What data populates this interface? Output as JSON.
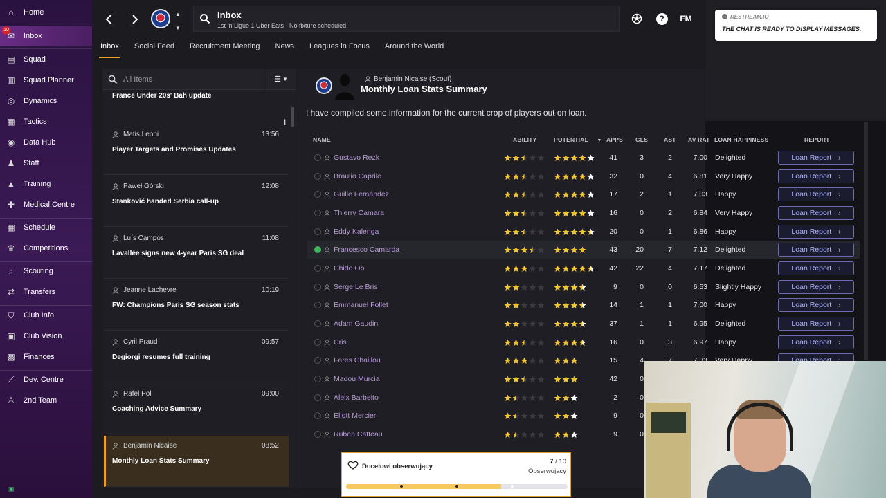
{
  "sidebar": {
    "items": [
      {
        "label": "Home",
        "icon": "home-icon"
      },
      {
        "label": "Inbox",
        "icon": "inbox-icon",
        "badge": "10"
      },
      {
        "label": "Squad",
        "icon": "shirt-icon"
      },
      {
        "label": "Squad Planner",
        "icon": "clipboard-icon"
      },
      {
        "label": "Dynamics",
        "icon": "dynamics-icon"
      },
      {
        "label": "Tactics",
        "icon": "tactics-icon"
      },
      {
        "label": "Data Hub",
        "icon": "data-hub-icon"
      },
      {
        "label": "Staff",
        "icon": "staff-icon"
      },
      {
        "label": "Training",
        "icon": "training-icon"
      },
      {
        "label": "Medical Centre",
        "icon": "medical-icon"
      },
      {
        "label": "Schedule",
        "icon": "calendar-icon"
      },
      {
        "label": "Competitions",
        "icon": "trophy-icon"
      },
      {
        "label": "Scouting",
        "icon": "search-icon"
      },
      {
        "label": "Transfers",
        "icon": "transfer-icon"
      },
      {
        "label": "Club Info",
        "icon": "shield-icon"
      },
      {
        "label": "Club Vision",
        "icon": "vision-icon"
      },
      {
        "label": "Finances",
        "icon": "money-icon"
      },
      {
        "label": "Dev. Centre",
        "icon": "dev-centre-icon"
      },
      {
        "label": "2nd Team",
        "icon": "team-icon"
      }
    ]
  },
  "header": {
    "title": "Inbox",
    "subtitle": "1st in Ligue 1 Uber Eats - No fixture scheduled.",
    "fm_label": "FM",
    "help_label": "?"
  },
  "tabs": [
    "Inbox",
    "Social Feed",
    "Recruitment Meeting",
    "News",
    "Leagues in Focus",
    "Around the World"
  ],
  "chat": {
    "source": "RESTREAM.IO",
    "message": "THE CHAT IS READY TO DISPLAY MESSAGES."
  },
  "message_list": {
    "search_placeholder": "All Items",
    "first_subject": "France Under 20s' Bah update",
    "items": [
      {
        "sender": "Matis Leoni",
        "time": "13:56",
        "subject": "Player Targets and Promises Updates"
      },
      {
        "sender": "Paweł Górski",
        "time": "12:08",
        "subject": "Stanković handed Serbia call-up"
      },
      {
        "sender": "Luís Campos",
        "time": "11:08",
        "subject": "Lavallée signs new 4-year Paris SG deal"
      },
      {
        "sender": "Jeanne Lachevre",
        "time": "10:19",
        "subject": "FW: Champions Paris SG season stats"
      },
      {
        "sender": "Cyril Praud",
        "time": "09:57",
        "subject": "Degiorgi resumes full training"
      },
      {
        "sender": "Rafel Pol",
        "time": "09:00",
        "subject": "Coaching Advice Summary"
      },
      {
        "sender": "Benjamin Nicaise",
        "time": "08:52",
        "subject": "Monthly Loan Stats Summary"
      }
    ]
  },
  "detail": {
    "from": "Benjamin Nicaise",
    "role": "(Scout)",
    "title": "Monthly Loan Stats Summary",
    "body": "I have compiled some information for the current crop of players out on loan."
  },
  "table": {
    "headers": {
      "name": "NAME",
      "ability": "ABILITY",
      "potential": "POTENTIAL",
      "apps": "APPS",
      "gls": "GLS",
      "ast": "AST",
      "avrat": "AV RAT",
      "happiness": "LOAN HAPPINESS",
      "report": "REPORT"
    },
    "button_label": "Loan Report",
    "rows": [
      {
        "name": "Gustavo Rezk",
        "ability": 2.5,
        "potential": 5,
        "potential_gold": 4,
        "apps": "41",
        "gls": "3",
        "ast": "2",
        "avrat": "7.00",
        "happiness": "Delighted"
      },
      {
        "name": "Braulio Caprile",
        "ability": 2.5,
        "potential": 5,
        "potential_gold": 4,
        "apps": "32",
        "gls": "0",
        "ast": "4",
        "avrat": "6.81",
        "happiness": "Very Happy"
      },
      {
        "name": "Guille Fernández",
        "ability": 2.5,
        "potential": 5,
        "potential_gold": 4,
        "apps": "17",
        "gls": "2",
        "ast": "1",
        "avrat": "7.03",
        "happiness": "Happy"
      },
      {
        "name": "Thierry Camara",
        "ability": 2.5,
        "potential": 5,
        "potential_gold": 4,
        "apps": "16",
        "gls": "0",
        "ast": "2",
        "avrat": "6.84",
        "happiness": "Very Happy"
      },
      {
        "name": "Eddy Kalenga",
        "ability": 2.5,
        "potential": 4.5,
        "potential_gold": 4,
        "apps": "20",
        "gls": "0",
        "ast": "1",
        "avrat": "6.86",
        "happiness": "Happy"
      },
      {
        "name": "Francesco Camarda",
        "ability": 3.5,
        "potential": 4,
        "potential_gold": 4,
        "apps": "43",
        "gls": "20",
        "ast": "7",
        "avrat": "7.12",
        "happiness": "Delighted",
        "highlight": true
      },
      {
        "name": "Chido Obi",
        "ability": 3,
        "potential": 4.5,
        "potential_gold": 4,
        "apps": "42",
        "gls": "22",
        "ast": "4",
        "avrat": "7.17",
        "happiness": "Delighted"
      },
      {
        "name": "Serge Le Bris",
        "ability": 2,
        "potential": 3.5,
        "potential_gold": 3,
        "apps": "9",
        "gls": "0",
        "ast": "0",
        "avrat": "6.53",
        "happiness": "Slightly Happy"
      },
      {
        "name": "Emmanuel Follet",
        "ability": 2,
        "potential": 3.5,
        "potential_gold": 3,
        "apps": "14",
        "gls": "1",
        "ast": "1",
        "avrat": "7.00",
        "happiness": "Happy"
      },
      {
        "name": "Adam Gaudin",
        "ability": 2,
        "potential": 3.5,
        "potential_gold": 3,
        "apps": "37",
        "gls": "1",
        "ast": "1",
        "avrat": "6.95",
        "happiness": "Delighted"
      },
      {
        "name": "Cris",
        "ability": 2.5,
        "potential": 3.5,
        "potential_gold": 3,
        "apps": "16",
        "gls": "0",
        "ast": "3",
        "avrat": "6.97",
        "happiness": "Happy"
      },
      {
        "name": "Fares Chaillou",
        "ability": 3,
        "potential": 3,
        "potential_gold": 3,
        "apps": "15",
        "gls": "4",
        "ast": "7",
        "avrat": "7.33",
        "happiness": "Very Happy"
      },
      {
        "name": "Madou Murcia",
        "ability": 2.5,
        "potential": 3,
        "potential_gold": 3,
        "apps": "42",
        "gls": "0",
        "ast": "",
        "avrat": "",
        "happiness": ""
      },
      {
        "name": "Aleix Barbeito",
        "ability": 1.5,
        "potential": 3,
        "potential_gold": 2,
        "apps": "2",
        "gls": "0",
        "ast": "",
        "avrat": "",
        "happiness": ""
      },
      {
        "name": "Eliott Mercier",
        "ability": 1.5,
        "potential": 3,
        "potential_gold": 2,
        "apps": "9",
        "gls": "0",
        "ast": "",
        "avrat": "",
        "happiness": ""
      },
      {
        "name": "Ruben Catteau",
        "ability": 1.5,
        "potential": 3,
        "potential_gold": 2,
        "apps": "9",
        "gls": "0",
        "ast": "",
        "avrat": "",
        "happiness": ""
      }
    ]
  },
  "toast": {
    "label": "Docelowi obserwujący",
    "count": "7",
    "total": "/ 10",
    "sub": "Obserwujący",
    "progress": 0.7
  },
  "colors": {
    "accent": "#f0a020",
    "star_gold": "#f2c42c",
    "star_white": "#ffffff",
    "sidebar": "#3b1a55",
    "link": "#b79bd6"
  }
}
